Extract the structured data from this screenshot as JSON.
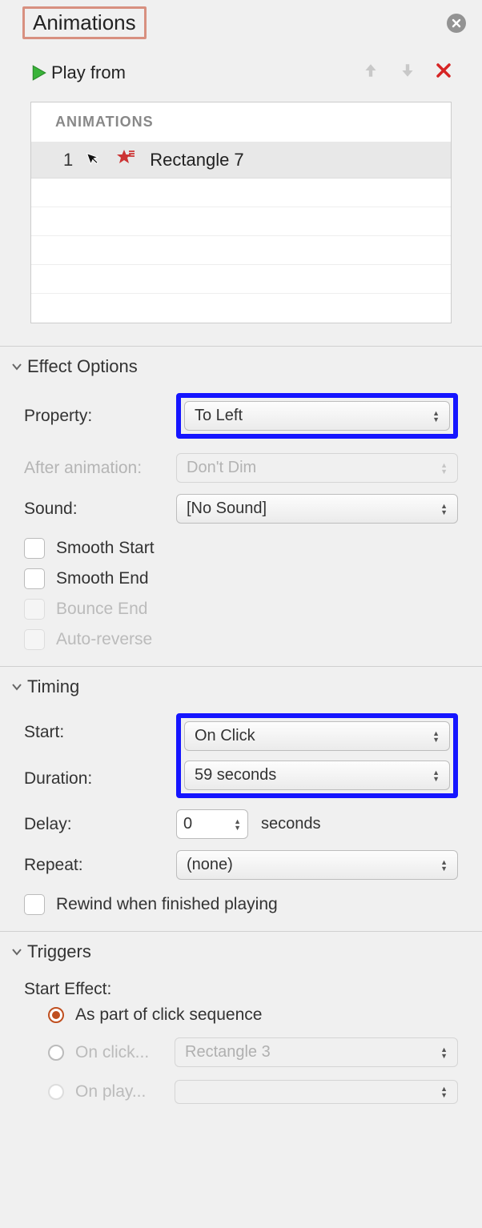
{
  "header": {
    "title": "Animations"
  },
  "playFrom": {
    "label": "Play from"
  },
  "animList": {
    "header": "ANIMATIONS",
    "item": {
      "index": "1",
      "name": "Rectangle 7"
    }
  },
  "effectOptions": {
    "title": "Effect Options",
    "property": {
      "label": "Property:",
      "value": "To Left"
    },
    "afterAnimation": {
      "label": "After animation:",
      "value": "Don't Dim"
    },
    "sound": {
      "label": "Sound:",
      "value": "[No Sound]"
    },
    "smoothStart": "Smooth Start",
    "smoothEnd": "Smooth End",
    "bounceEnd": "Bounce End",
    "autoReverse": "Auto-reverse"
  },
  "timing": {
    "title": "Timing",
    "start": {
      "label": "Start:",
      "value": "On Click"
    },
    "duration": {
      "label": "Duration:",
      "value": "59 seconds"
    },
    "delay": {
      "label": "Delay:",
      "value": "0",
      "unit": "seconds"
    },
    "repeat": {
      "label": "Repeat:",
      "value": "(none)"
    },
    "rewind": "Rewind when finished playing"
  },
  "triggers": {
    "title": "Triggers",
    "startEffect": "Start Effect:",
    "clickSequence": "As part of click sequence",
    "onClick": {
      "label": "On click...",
      "value": "Rectangle 3"
    },
    "onPlay": {
      "label": "On play...",
      "value": ""
    }
  }
}
